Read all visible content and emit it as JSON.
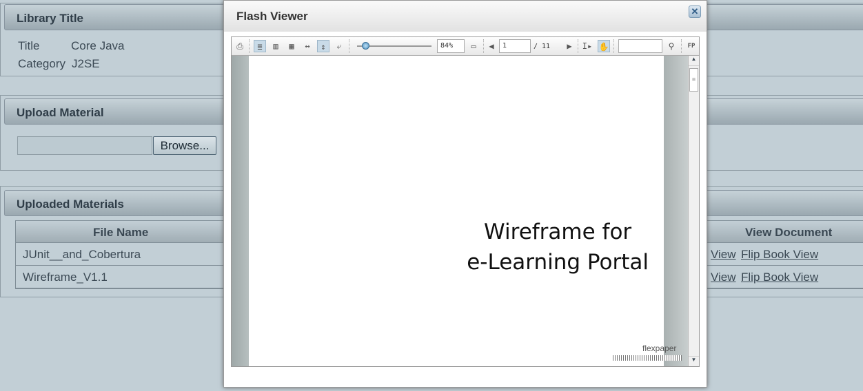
{
  "library": {
    "header": "Library Title",
    "title_label": "Title",
    "title_value": "Core Java",
    "category_label": "Category",
    "category_value": "J2SE"
  },
  "upload": {
    "header": "Upload Material",
    "file_value": "",
    "browse_label": "Browse..."
  },
  "materials": {
    "header": "Uploaded Materials",
    "col_file": "File Name",
    "col_view": "View Document",
    "rows": [
      {
        "file": "JUnit__and_Cobertura",
        "view": "View",
        "flip": "Flip Book View"
      },
      {
        "file": "Wireframe_V1.1",
        "view": "View",
        "flip": "Flip Book View"
      }
    ]
  },
  "dialog": {
    "title": "Flash Viewer",
    "close_icon": "close-icon",
    "toolbar": {
      "zoom": "84%",
      "page": "1",
      "page_total": "/ 11",
      "search": "",
      "fp": "FP",
      "zoom_slider_percent": 5
    },
    "document": {
      "line1": "Wireframe for",
      "line2": "e-Learning Portal",
      "brand": "flexpaper"
    }
  }
}
